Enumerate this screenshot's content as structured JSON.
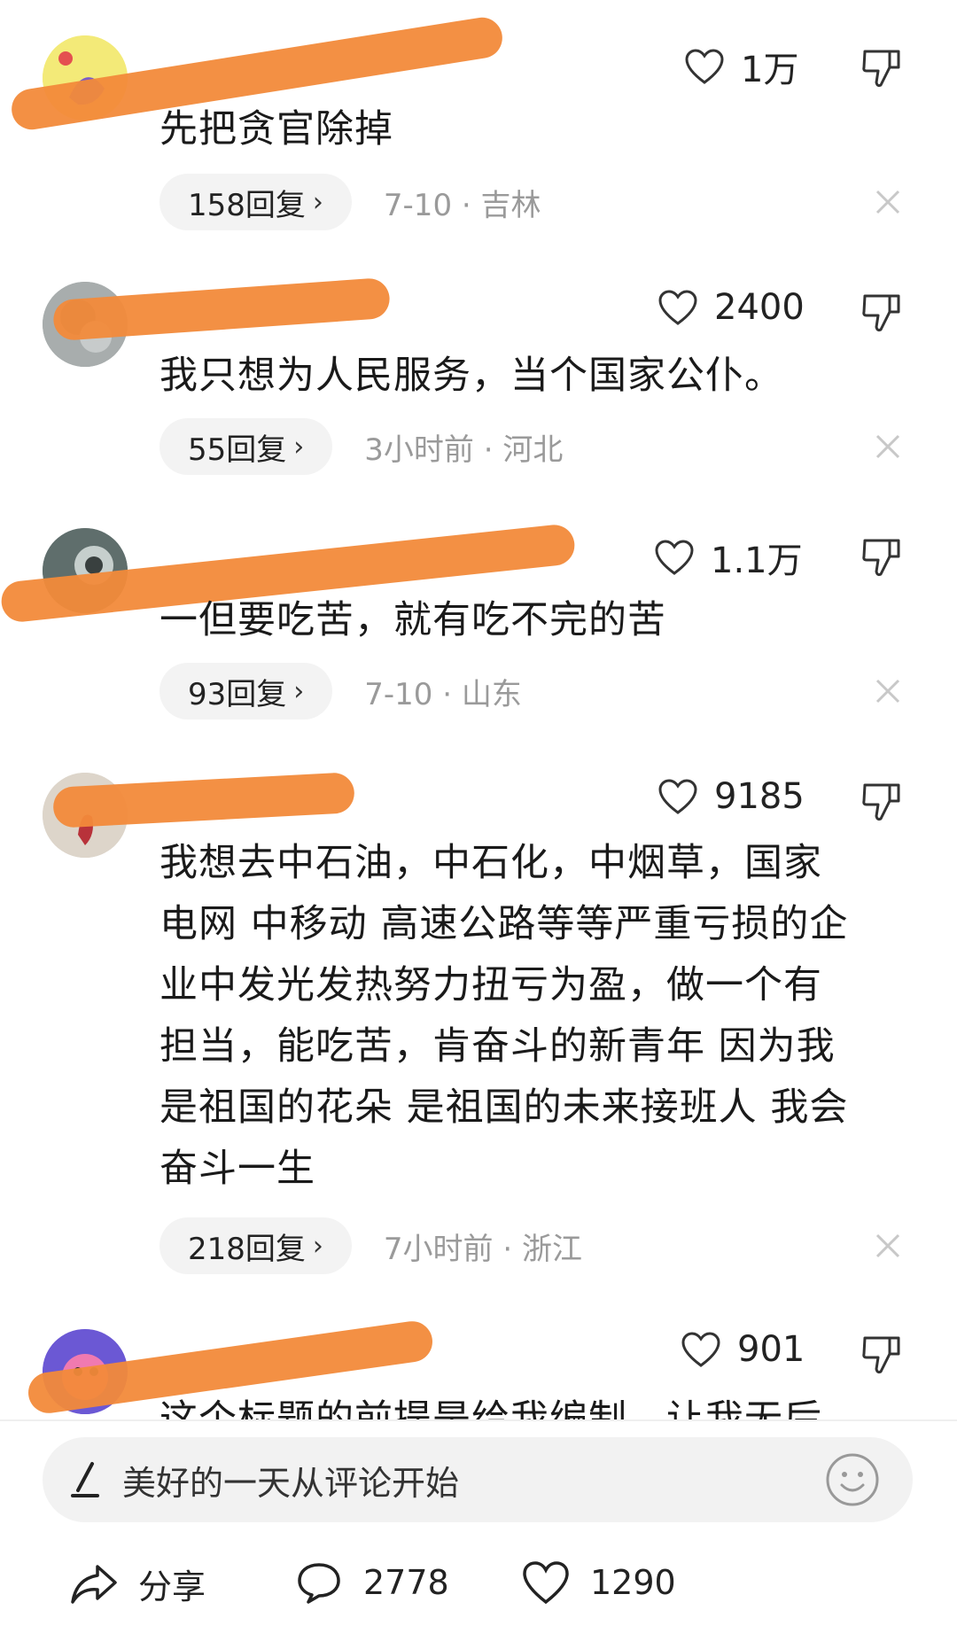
{
  "comments": [
    {
      "likes": "1万",
      "text_lines": [
        "先把贪官除掉"
      ],
      "replies": "158回复",
      "meta": "7-10 · 吉林"
    },
    {
      "likes": "2400",
      "text_lines": [
        "我只想为人民服务，当个国家公仆。"
      ],
      "replies": "55回复",
      "meta": "3小时前 · 河北"
    },
    {
      "likes": "1.1万",
      "text_lines": [
        "一但要吃苦，就有吃不完的苦"
      ],
      "replies": "93回复",
      "meta": "7-10 · 山东"
    },
    {
      "likes": "9185",
      "text_lines": [
        "我想去中石油，中石化，中烟草，国家",
        "电网 中移动 高速公路等等严重亏损的企",
        "业中发光发热努力扭亏为盈，做一个有",
        "担当，能吃苦，肯奋斗的新青年 因为我",
        "是祖国的花朵 是祖国的未来接班人 我会",
        "奋斗一生"
      ],
      "replies": "218回复",
      "meta": "7小时前 · 浙江"
    },
    {
      "likes": "901",
      "text_lines": [
        "这个标题的前提是给我编制，让我无后"
      ]
    }
  ],
  "input": {
    "placeholder": "美好的一天从评论开始"
  },
  "bottom_bar": {
    "share_label": "分享",
    "comment_count": "2778",
    "like_count": "1290"
  },
  "colors": {
    "redaction": "#f28a3a",
    "meta_text": "#9a9a9a",
    "pill_bg": "#f3f3f3"
  }
}
